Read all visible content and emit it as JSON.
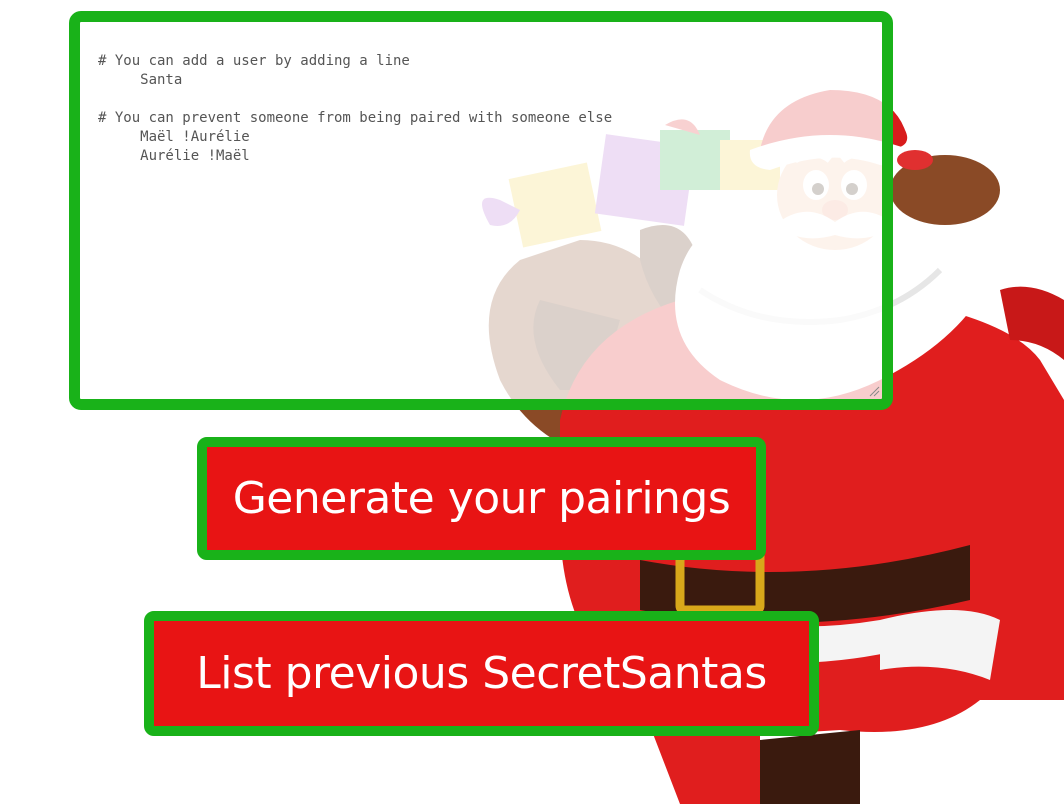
{
  "editor": {
    "content": "# You can add a user by adding a line\n     Santa\n\n# You can prevent someone from being paired with someone else\n     Maël !Aurélie\n     Aurélie !Maël"
  },
  "buttons": {
    "generate_label": "Generate your pairings",
    "list_label": "List previous SecretSantas"
  },
  "colors": {
    "frame_green": "#19b219",
    "button_red": "#e81414",
    "button_text": "#ffffff"
  },
  "illustration": {
    "subject": "santa-claus-with-gift-sack-illustration"
  }
}
